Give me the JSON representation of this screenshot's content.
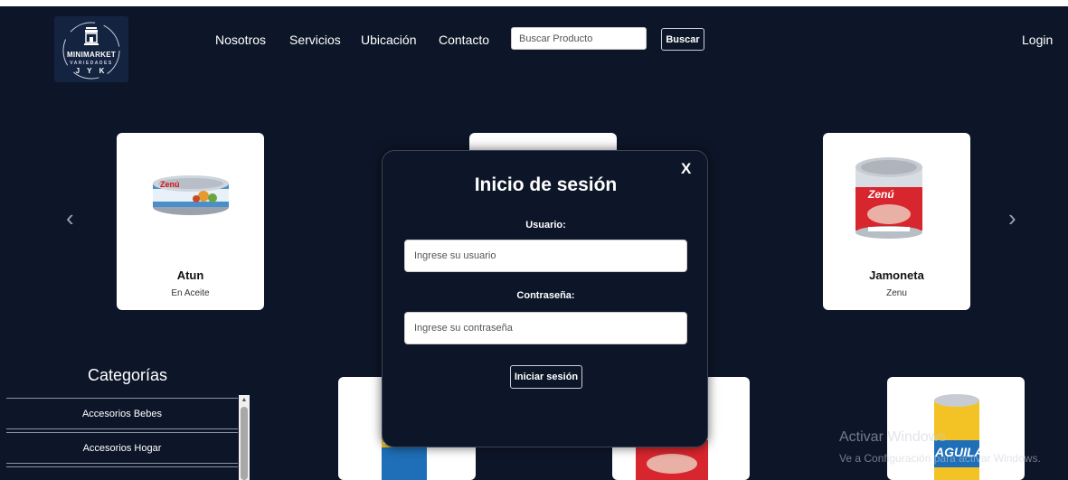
{
  "logo": {
    "name": "MINIMARKET",
    "subtitle": "VARIEDADES",
    "initials": "J Y K"
  },
  "nav": {
    "about": "Nosotros",
    "services": "Servicios",
    "location": "Ubicación",
    "contact": "Contacto"
  },
  "search": {
    "placeholder": "Buscar Producto",
    "button": "Buscar"
  },
  "login": "Login",
  "featured": [
    {
      "title": "Atun",
      "subtitle": "En Aceite"
    },
    {
      "title": "Jamoneta",
      "subtitle": "Zenu"
    }
  ],
  "categories": {
    "title": "Categorías",
    "items": [
      {
        "label": "Accesorios Bebes"
      },
      {
        "label": "Accesorios Hogar"
      }
    ]
  },
  "modal": {
    "title": "Inicio de sesión",
    "close": "X",
    "user_label": "Usuario:",
    "user_placeholder": "Ingrese su usuario",
    "password_label": "Contraseña:",
    "password_placeholder": "Ingrese su contraseña",
    "submit": "Iniciar sesión"
  },
  "arrows": {
    "prev": "‹",
    "next": "›"
  },
  "watermark": {
    "line1": "Activar Windows",
    "line2": "Ve a Configuración para activar Windows."
  },
  "colors": {
    "background": "#0d1628",
    "card": "#ffffff",
    "modal_border": "#3a4458"
  },
  "icons": [
    "store-icon",
    "chevron-left-icon",
    "chevron-right-icon",
    "close-icon",
    "scroll-up-icon"
  ]
}
